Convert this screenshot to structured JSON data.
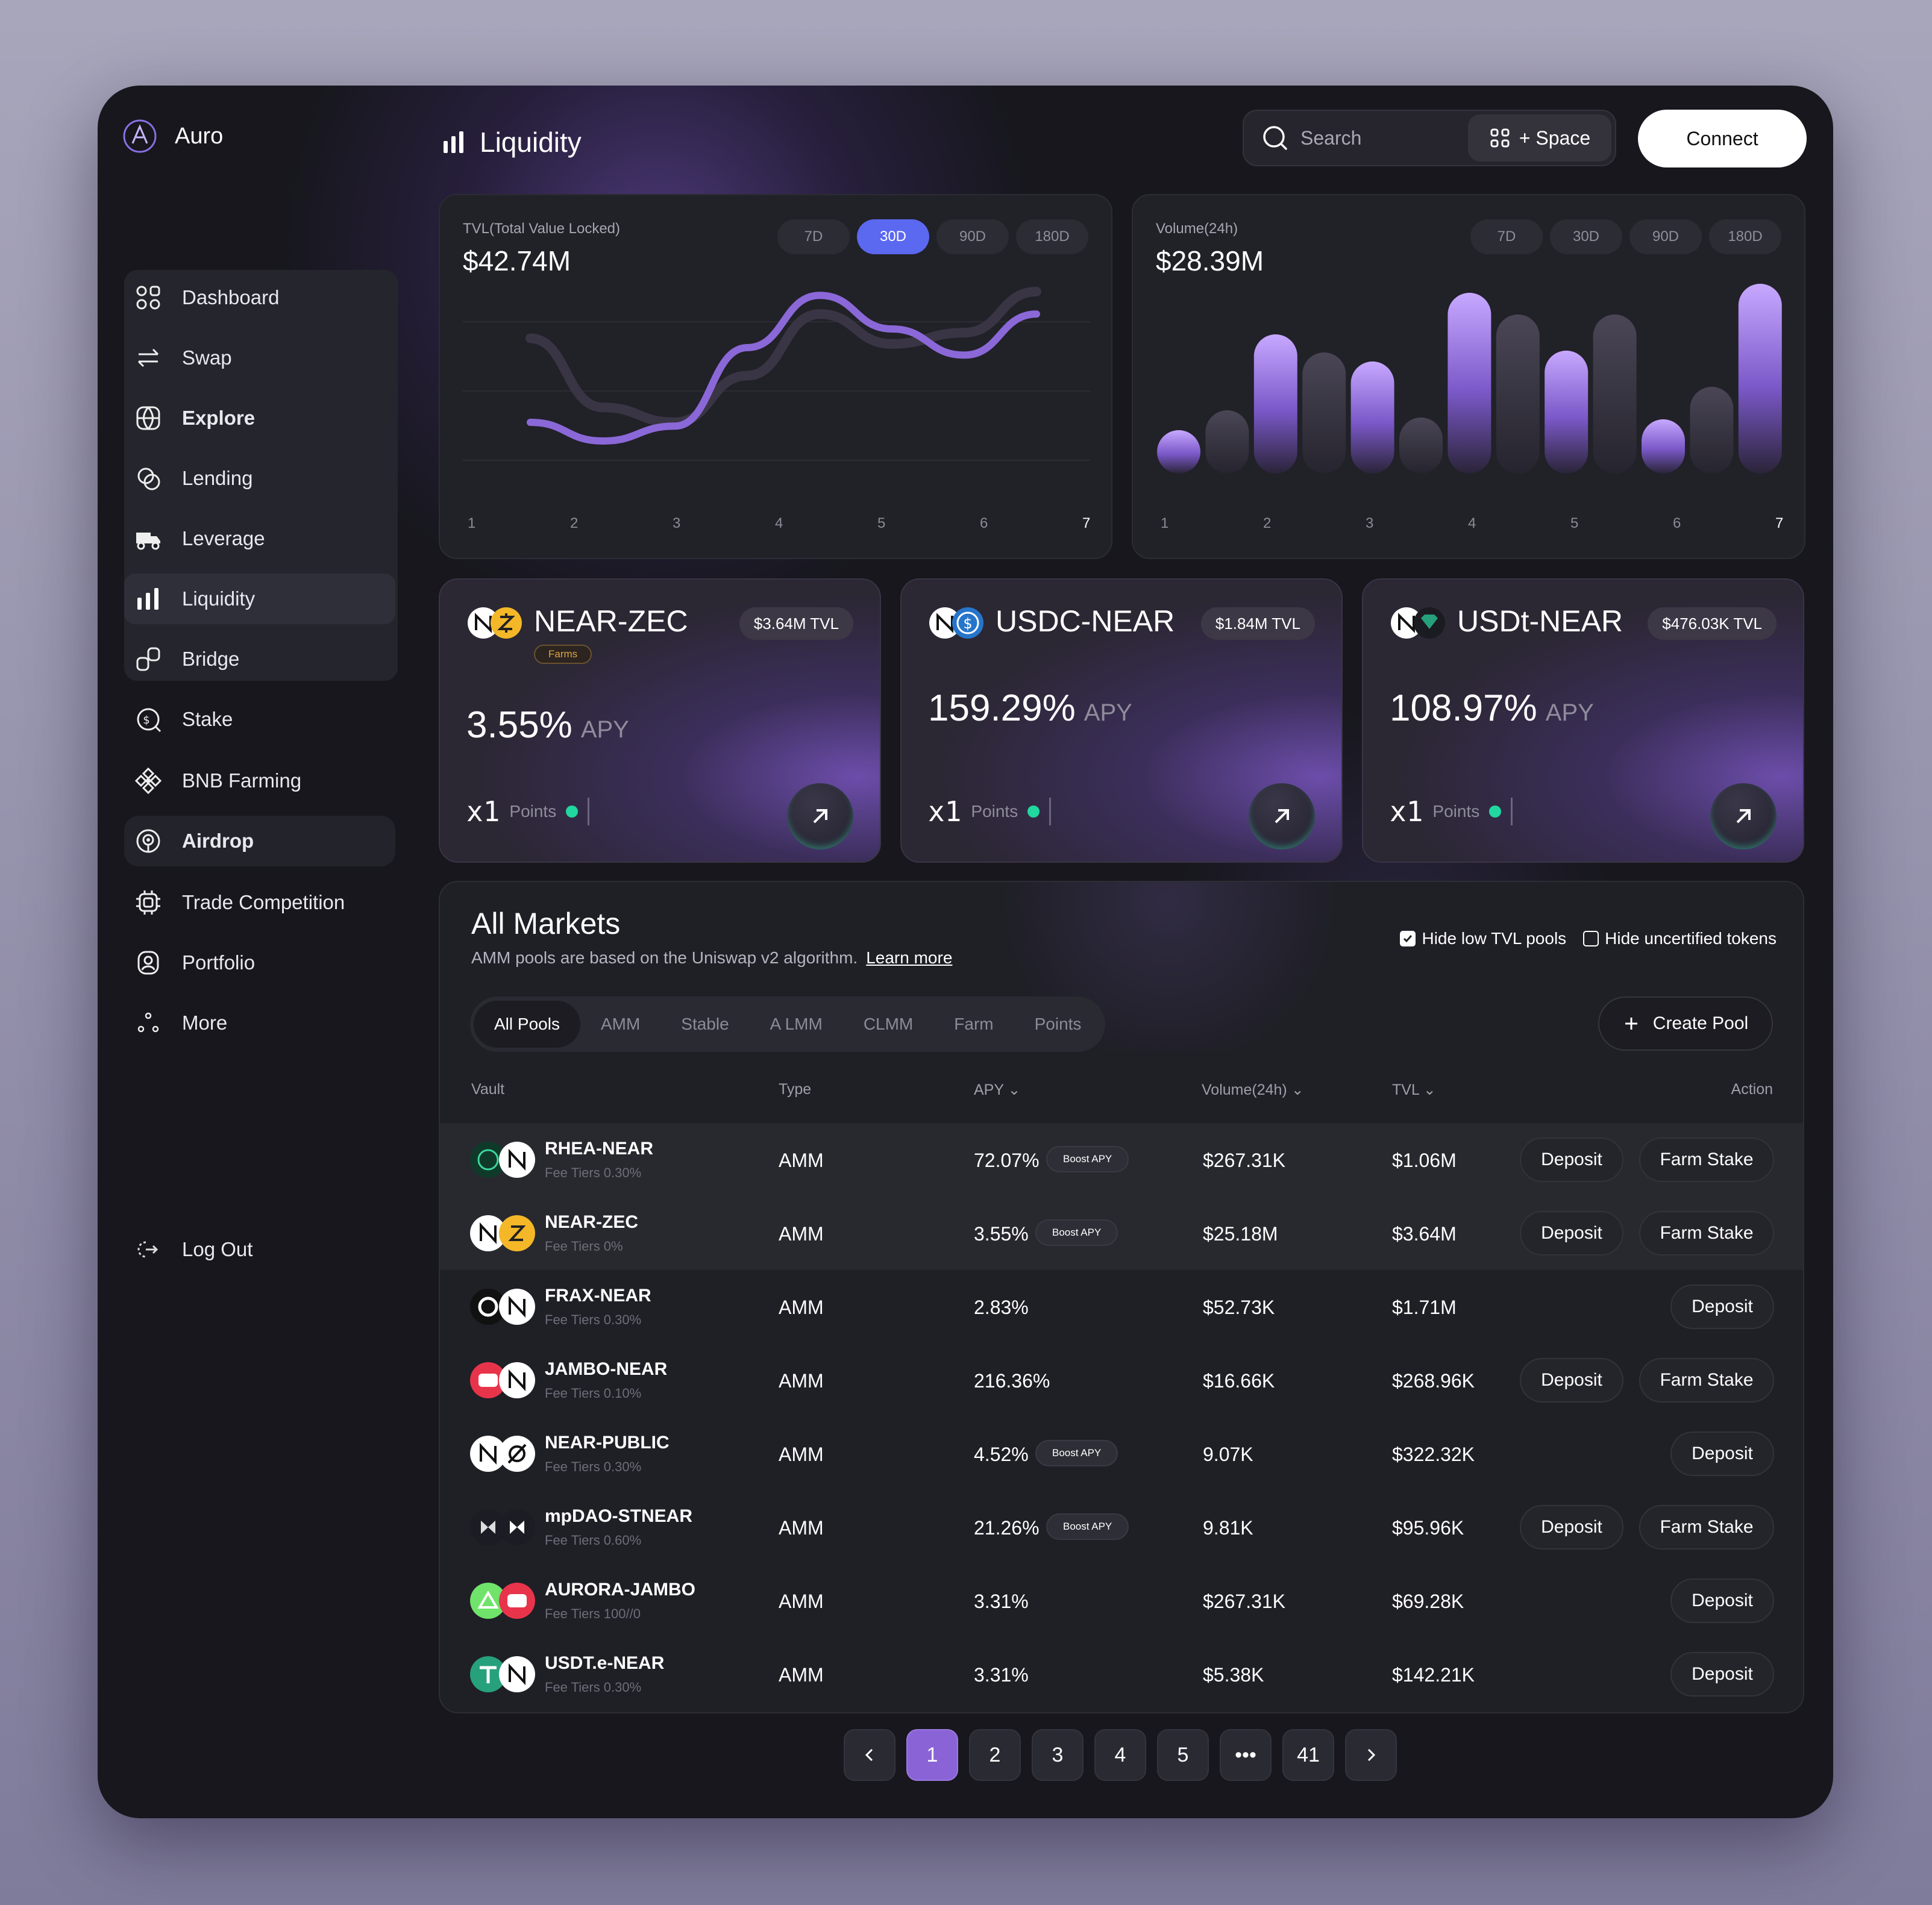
{
  "app": {
    "name": "Auro"
  },
  "sidebar": {
    "items": [
      {
        "label": "Dashboard",
        "icon": "dashboard-icon"
      },
      {
        "label": "Swap",
        "icon": "swap-icon"
      },
      {
        "label": "Explore",
        "icon": "globe-icon"
      },
      {
        "label": "Lending",
        "icon": "lending-icon"
      },
      {
        "label": "Leverage",
        "icon": "truck-icon"
      },
      {
        "label": "Liquidity",
        "icon": "bar-chart-icon"
      },
      {
        "label": "Bridge",
        "icon": "bridge-icon"
      },
      {
        "label": "Stake",
        "icon": "coin-icon"
      },
      {
        "label": "BNB Farming",
        "icon": "bnb-icon"
      },
      {
        "label": "Airdrop",
        "icon": "airdrop-icon"
      },
      {
        "label": "Trade Competition",
        "icon": "chip-icon"
      },
      {
        "label": "Portfolio",
        "icon": "user-icon"
      },
      {
        "label": "More",
        "icon": "dots-icon"
      }
    ],
    "logout": "Log Out"
  },
  "header": {
    "title": "Liquidity",
    "search_placeholder": "Search",
    "shortcut": "+ Space",
    "connect": "Connect"
  },
  "tvl_chart": {
    "label": "TVL(Total Value Locked)",
    "value": "$42.74M",
    "ranges": [
      "7D",
      "30D",
      "90D",
      "180D"
    ],
    "active_range": "30D",
    "x_labels": [
      "1",
      "2",
      "3",
      "4",
      "5",
      "6",
      "7"
    ]
  },
  "volume_chart": {
    "label": "Volume(24h)",
    "value": "$28.39M",
    "ranges": [
      "7D",
      "30D",
      "90D",
      "180D"
    ],
    "x_labels": [
      "1",
      "2",
      "3",
      "4",
      "5",
      "6",
      "7"
    ]
  },
  "chart_data": [
    {
      "type": "line",
      "x": [
        1,
        2,
        3,
        4,
        5,
        6,
        7
      ],
      "series": [
        {
          "values": [
            0.75,
            0.38,
            0.3,
            0.55,
            0.88,
            0.72,
            0.78,
            1.0
          ]
        },
        {
          "values": [
            0.3,
            0.2,
            0.28,
            0.7,
            0.98,
            0.8,
            0.66,
            0.88
          ]
        }
      ],
      "xlabel": "",
      "ylabel": ""
    },
    {
      "type": "bar",
      "categories": [
        "1",
        "2",
        "3",
        "4",
        "5",
        "6",
        "7"
      ],
      "series": [
        {
          "values": [
            0.2,
            0.35,
            0.77,
            0.67,
            0.62,
            0.31,
            1.0,
            0.88,
            0.68,
            0.88,
            0.3,
            0.48,
            1.05
          ]
        }
      ],
      "highlighted": [
        true,
        false,
        true,
        false,
        true,
        false,
        true,
        false,
        true,
        false,
        true,
        false,
        true
      ],
      "xlabel": "",
      "ylabel": ""
    }
  ],
  "pool_cards": [
    {
      "name": "NEAR-ZEC",
      "tvl": "$3.64M TVL",
      "tag": "Farms",
      "apy": "3.55%",
      "apy_unit": "APY",
      "multiplier": "x1",
      "points": "Points"
    },
    {
      "name": "USDC-NEAR",
      "tvl": "$1.84M TVL",
      "apy": "159.29%",
      "apy_unit": "APY",
      "multiplier": "x1",
      "points": "Points"
    },
    {
      "name": "USDt-NEAR",
      "tvl": "$476.03K TVL",
      "apy": "108.97%",
      "apy_unit": "APY",
      "multiplier": "x1",
      "points": "Points"
    }
  ],
  "markets": {
    "title": "All Markets",
    "subtitle": "AMM pools are based on the Uniswap v2 algorithm.",
    "learn_more": "Learn more",
    "hide_low_tvl": "Hide low TVL pools",
    "hide_uncertified": "Hide uncertified tokens",
    "filters": [
      "All Pools",
      "AMM",
      "Stable",
      "A LMM",
      "CLMM",
      "Farm",
      "Points"
    ],
    "create_pool": "Create Pool",
    "columns": {
      "vault": "Vault",
      "type": "Type",
      "apy": "APY",
      "volume": "Volume(24h)",
      "tvl": "TVL",
      "action": "Action"
    },
    "boost_label": "Boost APY",
    "deposit_label": "Deposit",
    "farm_label": "Farm Stake",
    "rows": [
      {
        "name": "RHEA-NEAR",
        "fee": "Fee Tiers 0.30%",
        "type": "AMM",
        "apy": "72.07%",
        "boost": true,
        "volume": "$267.31K",
        "tvl": "$1.06M",
        "farm": true
      },
      {
        "name": "NEAR-ZEC",
        "fee": "Fee Tiers 0%",
        "type": "AMM",
        "apy": "3.55%",
        "boost": true,
        "volume": "$25.18M",
        "tvl": "$3.64M",
        "farm": true
      },
      {
        "name": "FRAX-NEAR",
        "fee": "Fee Tiers 0.30%",
        "type": "AMM",
        "apy": "2.83%",
        "boost": false,
        "volume": "$52.73K",
        "tvl": "$1.71M",
        "farm": false
      },
      {
        "name": "JAMBO-NEAR",
        "fee": "Fee Tiers 0.10%",
        "type": "AMM",
        "apy": "216.36%",
        "boost": false,
        "volume": "$16.66K",
        "tvl": "$268.96K",
        "farm": true
      },
      {
        "name": "NEAR-PUBLIC",
        "fee": "Fee Tiers 0.30%",
        "type": "AMM",
        "apy": "4.52%",
        "boost": true,
        "volume": "9.07K",
        "tvl": "$322.32K",
        "farm": false
      },
      {
        "name": "mpDAO-STNEAR",
        "fee": "Fee Tiers 0.60%",
        "type": "AMM",
        "apy": "21.26%",
        "boost": true,
        "volume": "9.81K",
        "tvl": "$95.96K",
        "farm": true
      },
      {
        "name": "AURORA-JAMBO",
        "fee": "Fee Tiers 100//0",
        "type": "AMM",
        "apy": "3.31%",
        "boost": false,
        "volume": "$267.31K",
        "tvl": "$69.28K",
        "farm": false
      },
      {
        "name": "USDT.e-NEAR",
        "fee": "Fee Tiers 0.30%",
        "type": "AMM",
        "apy": "3.31%",
        "boost": false,
        "volume": "$5.38K",
        "tvl": "$142.21K",
        "farm": false
      }
    ]
  },
  "pagination": {
    "pages": [
      "1",
      "2",
      "3",
      "4",
      "5",
      "•••",
      "41"
    ],
    "active": "1"
  }
}
